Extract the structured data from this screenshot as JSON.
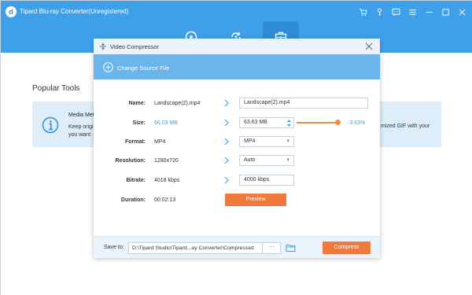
{
  "app": {
    "title": "Tipard Blu-ray Converter(Unregistered)",
    "logo_letter": "d"
  },
  "nav": {
    "tabs": [
      {
        "icon": "disc-icon",
        "active": false
      },
      {
        "icon": "convert-icon",
        "active": false
      },
      {
        "icon": "toolbox-icon",
        "active": true
      }
    ]
  },
  "background": {
    "popular_title": "Popular Tools",
    "tool_name": "Media Met",
    "tool_desc": "Keep origi you want",
    "tool_right_desc": "mized GIF with your"
  },
  "dialog": {
    "title": "Video Compressor",
    "change_source": "Change Source File",
    "rows": {
      "name": {
        "label": "Name:",
        "original": "Landscape(2).mp4",
        "output": "Landscape(2).mp4"
      },
      "size": {
        "label": "Size:",
        "original": "66.03 MB",
        "output": "63.63 MB",
        "percent": "-3.63%"
      },
      "format": {
        "label": "Format:",
        "original": "MP4",
        "output": "MP4"
      },
      "resolution": {
        "label": "Resolution:",
        "original": "1280x720",
        "output": "Auto"
      },
      "bitrate": {
        "label": "Bitrate:",
        "original": "4018 kbps",
        "output": "4000 kbps"
      },
      "duration": {
        "label": "Duration:",
        "original": "00:02:13"
      }
    },
    "preview_label": "Preview",
    "footer": {
      "save_to_label": "Save to:",
      "save_path": "D:\\Tipard Studio\\Tipard...ay Converter\\Compressed",
      "browse_label": "···",
      "compress_label": "Compress"
    }
  },
  "colors": {
    "header_blue": "#3fa0ea",
    "accent_orange": "#f07a3d",
    "light_blue": "#eaf3fb"
  }
}
